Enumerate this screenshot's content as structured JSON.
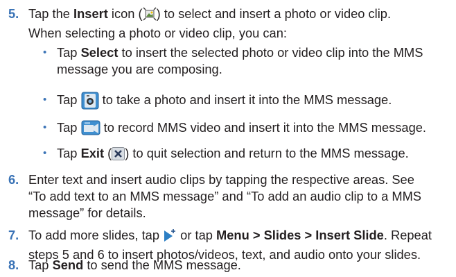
{
  "step5": {
    "number": "5.",
    "tap": "Tap the ",
    "insert": "Insert",
    "icon_open": " icon (",
    "icon_close": ") to select and insert a photo or video clip.",
    "line2": "When selecting a photo or video clip, you can:",
    "bullets": [
      {
        "pre": "Tap ",
        "bold": "Select",
        "post": " to insert the selected photo or video clip into the MMS",
        "post2": "message you are composing."
      },
      {
        "pre": "Tap ",
        "post": " to take a photo and insert it into the MMS message.",
        "icon": "camera-icon"
      },
      {
        "pre": "Tap ",
        "post": " to record MMS video and insert it into the MMS message.",
        "icon": "video-camera-icon"
      },
      {
        "pre": "Tap ",
        "bold": "Exit",
        "mid": " (",
        "post": ") to quit selection and return to the MMS message.",
        "icon": "close-icon"
      }
    ]
  },
  "step6": {
    "number": "6.",
    "line1": "Enter text and insert audio clips by tapping the respective areas. See",
    "line2": "“To add text to an MMS message” and “To add an audio clip to a MMS",
    "line3": "message” for details."
  },
  "step7": {
    "number": "7.",
    "pre": "To add more slides, tap ",
    "mid": " or tap ",
    "menu": "Menu",
    "sep1": " > ",
    "slides": "Slides",
    "sep2": " > ",
    "insert_slide": "Insert Slide",
    "post": ". Repeat",
    "line2": "steps 5 and 6 to insert photos/videos, text, and audio onto your slides.",
    "icon": "add-slide-icon"
  },
  "step8": {
    "number": "8.",
    "tap": "Tap ",
    "send": "Send",
    "post": " to send the MMS message."
  },
  "colors": {
    "number": "#3a73b6",
    "text": "#231f20",
    "icon_blue": "#2d7fc4"
  }
}
